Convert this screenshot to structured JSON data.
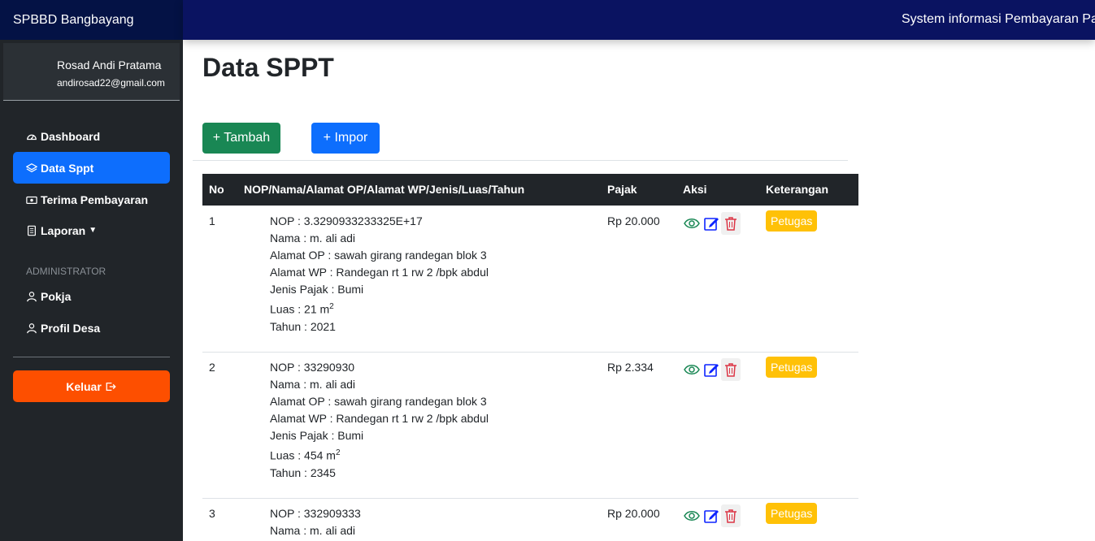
{
  "app": {
    "brand": "SPBBD Bangbayang",
    "header_title": "System informasi Pembayaran Pajak Bumi dan Bangunan"
  },
  "user": {
    "name": "Rosad Andi Pratama",
    "email": "andirosad22@gmail.com"
  },
  "sidebar": {
    "items": [
      {
        "label": "Dashboard",
        "icon": "speedometer-icon"
      },
      {
        "label": "Data Sppt",
        "icon": "layers-icon",
        "active": true
      },
      {
        "label": "Terima Pembayaran",
        "icon": "cash-icon"
      },
      {
        "label": "Laporan",
        "icon": "document-icon"
      }
    ],
    "section_label": "ADMINISTRATOR",
    "admin_items": [
      {
        "label": "Pokja",
        "icon": "person-icon"
      },
      {
        "label": "Profil Desa",
        "icon": "person-icon"
      }
    ],
    "logout_label": "Keluar"
  },
  "main": {
    "title": "Data SPPT",
    "add_button": "+ Tambah",
    "import_button": "+ Impor",
    "table": {
      "headers": [
        "No",
        "NOP/Nama/Alamat OP/Alamat WP/Jenis/Luas/Tahun",
        "Pajak",
        "Aksi",
        "Keterangan"
      ],
      "rows": [
        {
          "no": "1",
          "nop": "NOP : 3.3290933233325E+17",
          "nama": "Nama : m. ali adi",
          "alamat_op": "Alamat OP : sawah girang randegan blok 3",
          "alamat_wp": "Alamat WP : Randegan rt 1 rw 2 /bpk abdul",
          "jenis": "Jenis Pajak : Bumi",
          "luas": "Luas : 21 m",
          "tahun": "Tahun : 2021",
          "pajak": "Rp 20.000",
          "keterangan": "Petugas"
        },
        {
          "no": "2",
          "nop": "NOP : 33290930",
          "nama": "Nama : m. ali adi",
          "alamat_op": "Alamat OP : sawah girang randegan blok 3",
          "alamat_wp": "Alamat WP : Randegan rt 1 rw 2 /bpk abdul",
          "jenis": "Jenis Pajak : Bumi",
          "luas": "Luas : 454 m",
          "tahun": "Tahun : 2345",
          "pajak": "Rp 2.334",
          "keterangan": "Petugas"
        },
        {
          "no": "3",
          "nop": "NOP : 332909333",
          "nama": "Nama : m. ali adi",
          "alamat_op": "",
          "alamat_wp": "",
          "jenis": "",
          "luas": "",
          "tahun": "",
          "pajak": "Rp 20.000",
          "keterangan": "Petugas"
        }
      ],
      "unit_superscript": "2"
    }
  },
  "colors": {
    "brand_bg": "#041245",
    "header_bg": "#0a1361",
    "sidebar_bg": "#212529",
    "active_item": "#0d6efd",
    "logout": "#fd4f00",
    "tambah": "#198754",
    "impor": "#0d6efd",
    "badge": "#ffc107"
  }
}
